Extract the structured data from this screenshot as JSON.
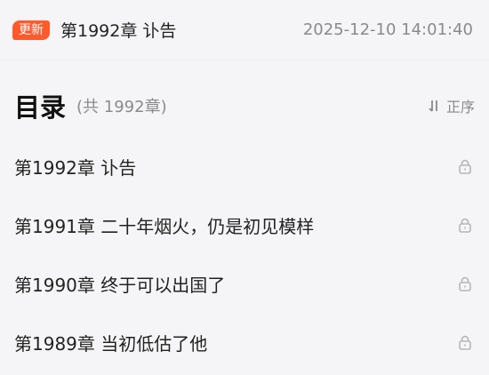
{
  "latest_update": {
    "badge": "更新",
    "chapter_title": "第1992章 讣告",
    "timestamp": "2025-12-10 14:01:40"
  },
  "toc": {
    "title": "目录",
    "count_text": "(共 1992章)",
    "sort_label": "正序"
  },
  "chapters": [
    {
      "title": "第1992章 讣告",
      "icon": "lock-icon"
    },
    {
      "title": "第1991章 二十年烟火，仍是初见模样",
      "icon": "lock-icon"
    },
    {
      "title": "第1990章 终于可以出国了",
      "icon": "lock-icon"
    },
    {
      "title": "第1989章 当初低估了他",
      "icon": "lock-icon"
    }
  ],
  "colors": {
    "badge": "#ff5a2c",
    "muted_text": "#8a8a8e",
    "background": "#f5f5f7"
  }
}
